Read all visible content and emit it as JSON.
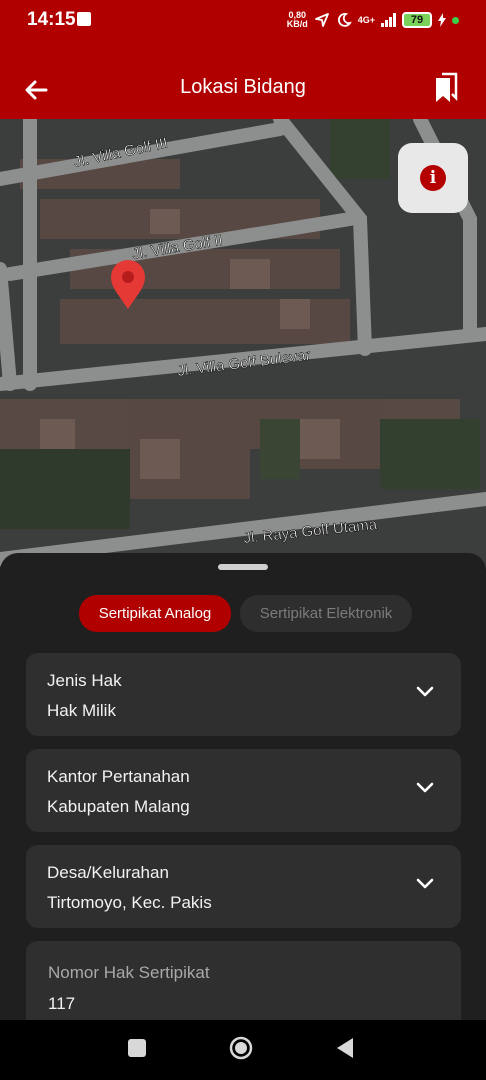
{
  "status_bar": {
    "time": "14:15",
    "net_speed_value": "0,80",
    "net_speed_unit": "KB/d",
    "network_type": "4G+",
    "battery": "79"
  },
  "app_bar": {
    "title": "Lokasi Bidang"
  },
  "map": {
    "street_labels": [
      "Jl. Villa Golf III",
      "Jl. Villa Golf II",
      "Jl. Villa Golf Bulevar",
      "Jl. Raya Golf Utama"
    ]
  },
  "certificate_tabs": {
    "active": "Sertipikat Analog",
    "inactive": "Sertipikat Elektronik"
  },
  "fields": {
    "jenis_hak": {
      "label": "Jenis Hak",
      "value": "Hak Milik"
    },
    "kantor_pertanahan": {
      "label": "Kantor Pertanahan",
      "value": "Kabupaten Malang"
    },
    "desa_kelurahan": {
      "label": "Desa/Kelurahan",
      "value": "Tirtomoyo, Kec. Pakis"
    },
    "nomor_hak": {
      "label": "Nomor Hak Sertipikat",
      "value": "117"
    }
  },
  "colors": {
    "brand_red": "#b00000",
    "sheet_bg": "#1f1f1f",
    "field_bg": "#2f2f2f"
  }
}
